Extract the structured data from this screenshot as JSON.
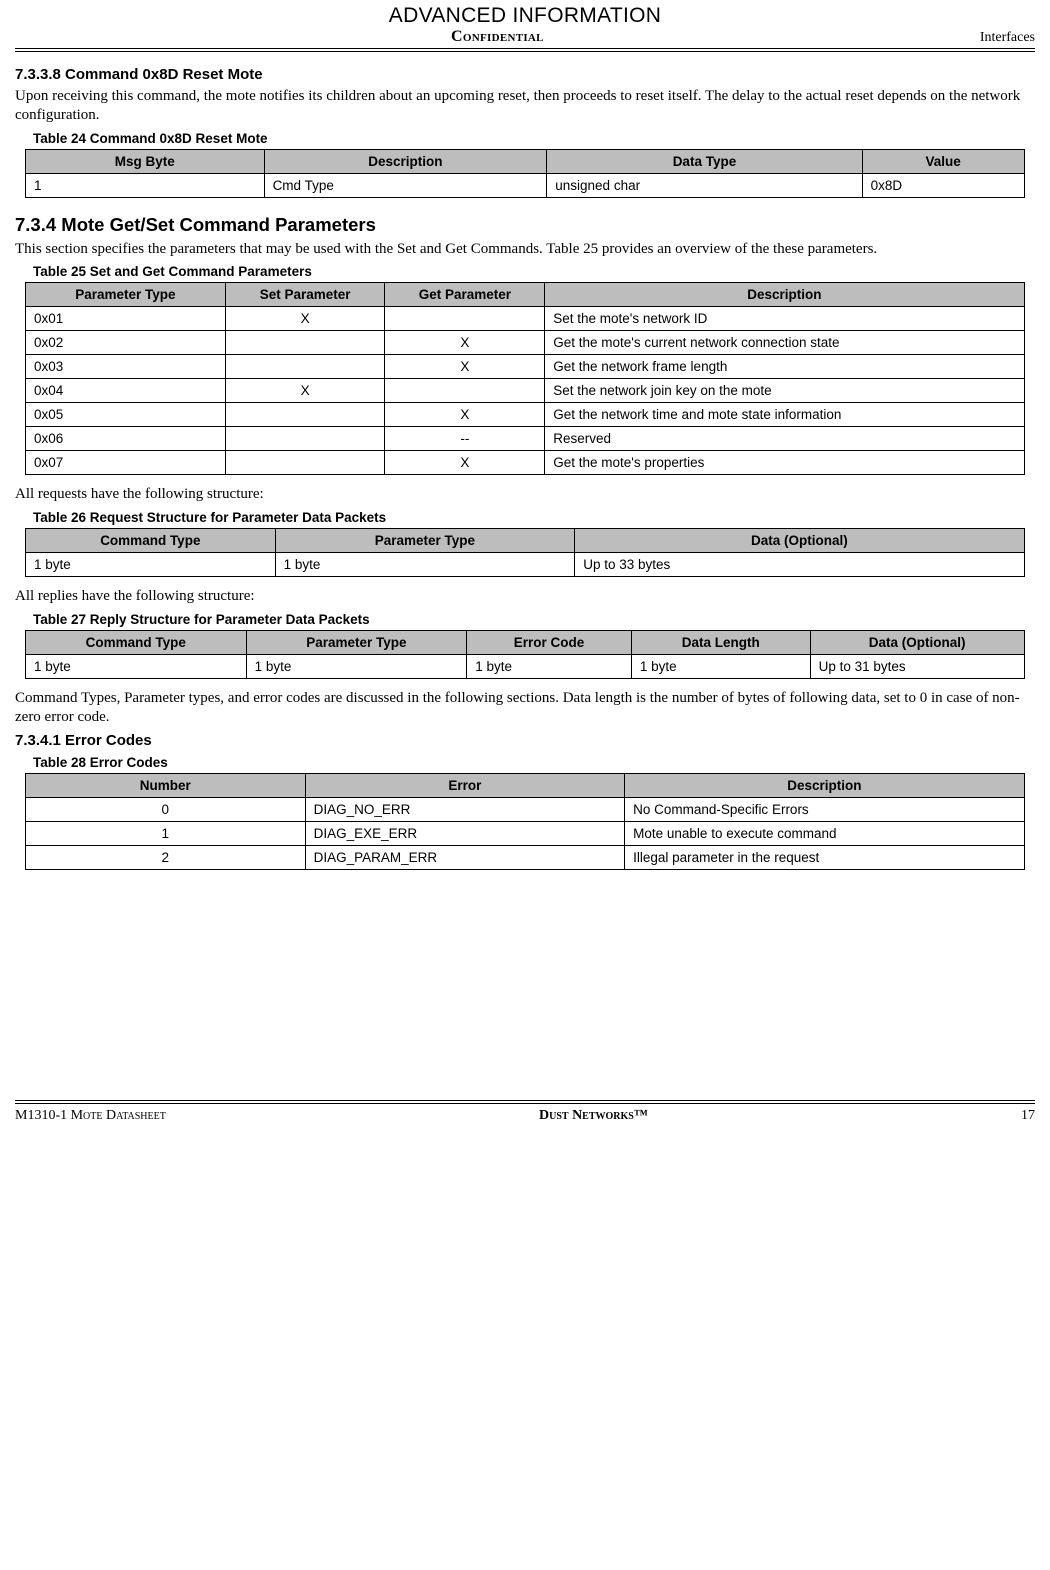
{
  "header": {
    "top": "ADVANCED INFORMATION",
    "center": "Confidential",
    "right": "Interfaces"
  },
  "sec7338": {
    "heading": "7.3.3.8      Command 0x8D Reset Mote",
    "body": "Upon receiving this command, the mote notifies its children about an upcoming reset, then proceeds to reset itself. The delay to the actual reset depends on the network configuration."
  },
  "table24": {
    "caption": "Table 24   Command 0x8D Reset Mote",
    "headers": [
      "Msg Byte",
      "Description",
      "Data Type",
      "Value"
    ],
    "rows": [
      [
        "1",
        "Cmd Type",
        "unsigned char",
        "0x8D"
      ]
    ]
  },
  "sec734": {
    "heading": "7.3.4       Mote Get/Set Command Parameters",
    "body": "This section specifies the parameters that may be used with the Set and Get Commands. Table 25 provides an overview of the these parameters."
  },
  "table25": {
    "caption": "Table 25   Set and Get Command Parameters",
    "headers": [
      "Parameter Type",
      "Set Parameter",
      "Get Parameter",
      "Description"
    ],
    "rows": [
      [
        "0x01",
        "X",
        "",
        "Set the mote's network ID"
      ],
      [
        "0x02",
        "",
        "X",
        "Get the mote's current network connection state"
      ],
      [
        "0x03",
        "",
        "X",
        "Get the network frame length"
      ],
      [
        "0x04",
        "X",
        "",
        "Set the network join key on the mote"
      ],
      [
        "0x05",
        "",
        "X",
        "Get the network time and mote state information"
      ],
      [
        "0x06",
        "",
        "--",
        "Reserved"
      ],
      [
        "0x07",
        "",
        "X",
        "Get the mote's properties"
      ]
    ]
  },
  "pre26": "All requests have the following structure:",
  "table26": {
    "caption": "Table 26   Request Structure for Parameter Data Packets",
    "headers": [
      "Command Type",
      "Parameter Type",
      "Data (Optional)"
    ],
    "rows": [
      [
        "1 byte",
        "1 byte",
        "Up to 33 bytes"
      ]
    ]
  },
  "pre27": "All replies have the following structure:",
  "table27": {
    "caption": "Table 27   Reply Structure for Parameter Data Packets",
    "headers": [
      "Command Type",
      "Parameter Type",
      "Error Code",
      "Data Length",
      "Data (Optional)"
    ],
    "rows": [
      [
        "1 byte",
        "1 byte",
        "1 byte",
        "1 byte",
        "Up to 31 bytes"
      ]
    ]
  },
  "post27": "Command Types, Parameter types, and error codes are discussed in the following sections. Data length is the number of bytes of following data, set to 0 in case of non-zero error code.",
  "sec7341": {
    "heading": "7.3.4.1      Error Codes"
  },
  "table28": {
    "caption": "Table 28   Error Codes",
    "headers": [
      "Number",
      "Error",
      "Description"
    ],
    "rows": [
      [
        "0",
        "DIAG_NO_ERR",
        "No Command-Specific Errors"
      ],
      [
        "1",
        "DIAG_EXE_ERR",
        "Mote unable to execute command"
      ],
      [
        "2",
        "DIAG_PARAM_ERR",
        "Illegal parameter in the request"
      ]
    ]
  },
  "footer": {
    "left": "M1310-1 Mote Datasheet",
    "center": "Dust Networks™",
    "right": "17"
  }
}
